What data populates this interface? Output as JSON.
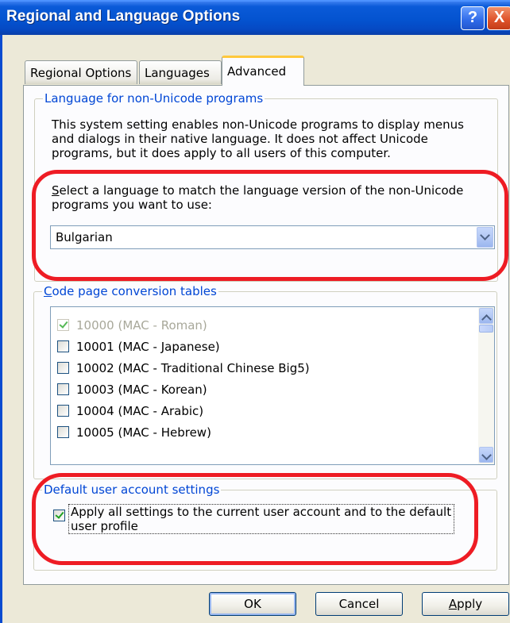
{
  "window": {
    "title": "Regional and Language Options",
    "help_label": "?",
    "close_label": "X"
  },
  "tabs": [
    {
      "label": "Regional Options"
    },
    {
      "label": "Languages"
    },
    {
      "label": "Advanced"
    }
  ],
  "non_unicode": {
    "group_label": "Language for non-Unicode programs",
    "description": "This system setting enables non-Unicode programs to display menus and dialogs in their native language. It does not affect Unicode programs, but it does apply to all users of this computer.",
    "prompt": "Select a language to match the language version of the non-Unicode programs you want to use:",
    "selected_language": "Bulgarian"
  },
  "code_page": {
    "group_label": "Code page conversion tables",
    "items": [
      {
        "label": "10000 (MAC - Roman)",
        "checked": true,
        "disabled": true
      },
      {
        "label": "10001 (MAC - Japanese)",
        "checked": false,
        "disabled": false
      },
      {
        "label": "10002 (MAC - Traditional Chinese Big5)",
        "checked": false,
        "disabled": false
      },
      {
        "label": "10003 (MAC - Korean)",
        "checked": false,
        "disabled": false
      },
      {
        "label": "10004 (MAC - Arabic)",
        "checked": false,
        "disabled": false
      },
      {
        "label": "10005 (MAC - Hebrew)",
        "checked": false,
        "disabled": false
      }
    ]
  },
  "default_user": {
    "group_label": "Default user account settings",
    "checkbox_label": "Apply all settings to the current user account and to the default user profile",
    "checked": true
  },
  "buttons": {
    "ok": "OK",
    "cancel": "Cancel",
    "apply": "Apply"
  },
  "colors": {
    "titlebar": "#0453d0",
    "group_label": "#0046d5",
    "annotation": "#ee1c24"
  }
}
